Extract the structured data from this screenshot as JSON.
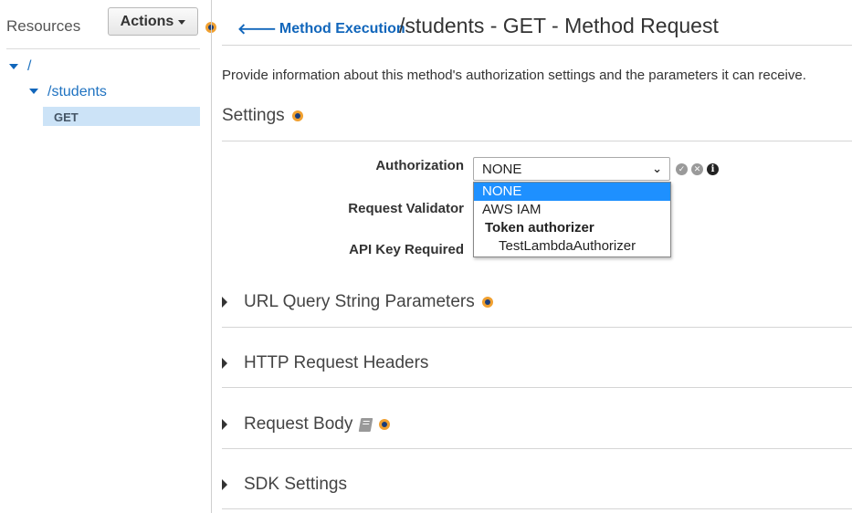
{
  "sidebar": {
    "resources_label": "Resources",
    "actions_label": "Actions",
    "tree": [
      {
        "label": "/"
      },
      {
        "label": "/students"
      },
      {
        "label": "GET"
      }
    ]
  },
  "header": {
    "back_link": "Method Execution",
    "title": "/students - GET - Method Request"
  },
  "main": {
    "description": "Provide information about this method's authorization settings and the parameters it can receive.",
    "settings_title": "Settings",
    "fields": {
      "authorization_label": "Authorization",
      "authorization_value": "NONE",
      "request_validator_label": "Request Validator",
      "api_key_label": "API Key Required"
    },
    "dropdown_options": [
      {
        "label": "NONE"
      },
      {
        "label": "AWS IAM"
      },
      {
        "label": "Token authorizer"
      },
      {
        "label": "TestLambdaAuthorizer"
      }
    ],
    "sections": [
      {
        "label": "URL Query String Parameters"
      },
      {
        "label": "HTTP Request Headers"
      },
      {
        "label": "Request Body"
      },
      {
        "label": "SDK Settings"
      }
    ]
  },
  "colors": {
    "link": "#1166bb",
    "selected_option": "#1e90ff",
    "tree_selected": "#cce3f7",
    "help_dot": "#f0a030"
  },
  "icons": {
    "help": "help-dot-icon",
    "back": "arrow-left-icon",
    "save": "check-circle-icon",
    "cancel": "x-circle-icon",
    "info": "info-icon",
    "expand": "caret-right-icon",
    "model": "book-icon"
  }
}
